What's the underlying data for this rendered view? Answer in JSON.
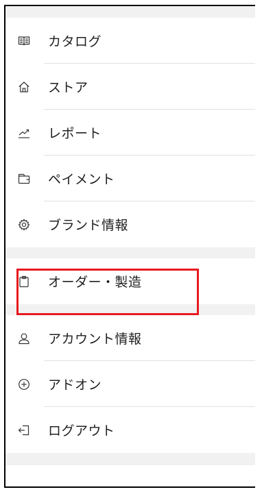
{
  "menu": {
    "group1": [
      {
        "label": "カタログ",
        "icon": "catalog-book-icon"
      },
      {
        "label": "ストア",
        "icon": "home-icon"
      },
      {
        "label": "レポート",
        "icon": "trend-chart-icon"
      },
      {
        "label": "ペイメント",
        "icon": "wallet-icon"
      },
      {
        "label": "ブランド情報",
        "icon": "gear-icon"
      }
    ],
    "group2": [
      {
        "label": "オーダー・製造",
        "icon": "clipboard-icon"
      }
    ],
    "group3": [
      {
        "label": "アカウント情報",
        "icon": "user-icon"
      },
      {
        "label": "アドオン",
        "icon": "plus-circle-icon"
      },
      {
        "label": "ログアウト",
        "icon": "logout-icon"
      }
    ]
  },
  "colors": {
    "highlight_border": "#e8191f",
    "section_gap": "#f1f1f1",
    "separator": "#e0e0e0"
  }
}
